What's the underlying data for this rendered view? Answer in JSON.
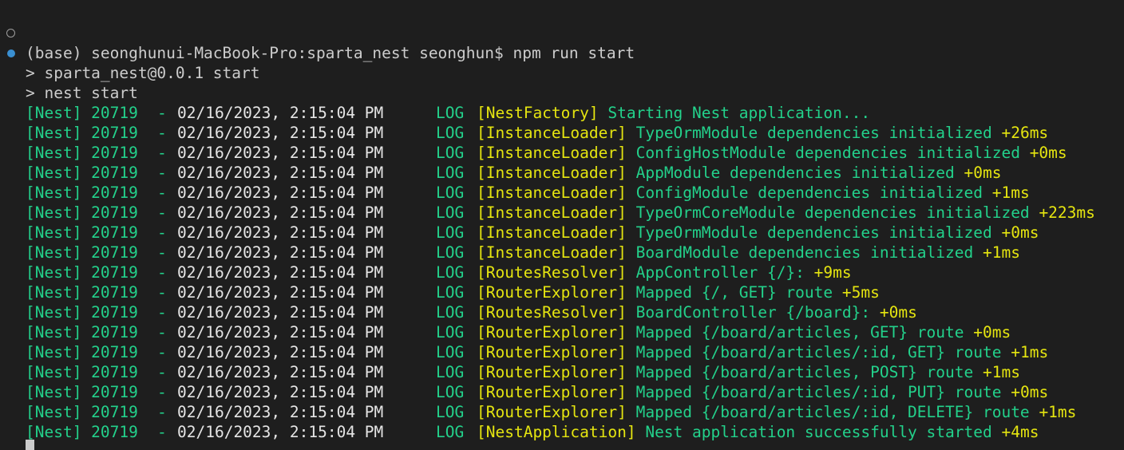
{
  "terminal": {
    "prompt_line": "(base) seonghunui-MacBook-Pro:sparta_nest seonghun$ npm run start",
    "script_line_1": "> sparta_nest@0.0.1 start",
    "script_line_2": "> nest start",
    "colors": {
      "background": "#1e1e1e",
      "default_text": "#cccccc",
      "log_green": "#23d18b",
      "timing_yellow": "#e5e510",
      "running_indicator": "#3a8fd1"
    },
    "log_entries": [
      {
        "prefix": "[Nest] 20719",
        "dash": "-",
        "timestamp": "02/16/2023, 2:15:04 PM",
        "level": "LOG",
        "context": "[NestFactory]",
        "message": "Starting Nest application...",
        "duration": ""
      },
      {
        "prefix": "[Nest] 20719",
        "dash": "-",
        "timestamp": "02/16/2023, 2:15:04 PM",
        "level": "LOG",
        "context": "[InstanceLoader]",
        "message": "TypeOrmModule dependencies initialized",
        "duration": "+26ms"
      },
      {
        "prefix": "[Nest] 20719",
        "dash": "-",
        "timestamp": "02/16/2023, 2:15:04 PM",
        "level": "LOG",
        "context": "[InstanceLoader]",
        "message": "ConfigHostModule dependencies initialized",
        "duration": "+0ms"
      },
      {
        "prefix": "[Nest] 20719",
        "dash": "-",
        "timestamp": "02/16/2023, 2:15:04 PM",
        "level": "LOG",
        "context": "[InstanceLoader]",
        "message": "AppModule dependencies initialized",
        "duration": "+0ms"
      },
      {
        "prefix": "[Nest] 20719",
        "dash": "-",
        "timestamp": "02/16/2023, 2:15:04 PM",
        "level": "LOG",
        "context": "[InstanceLoader]",
        "message": "ConfigModule dependencies initialized",
        "duration": "+1ms"
      },
      {
        "prefix": "[Nest] 20719",
        "dash": "-",
        "timestamp": "02/16/2023, 2:15:04 PM",
        "level": "LOG",
        "context": "[InstanceLoader]",
        "message": "TypeOrmCoreModule dependencies initialized",
        "duration": "+223ms"
      },
      {
        "prefix": "[Nest] 20719",
        "dash": "-",
        "timestamp": "02/16/2023, 2:15:04 PM",
        "level": "LOG",
        "context": "[InstanceLoader]",
        "message": "TypeOrmModule dependencies initialized",
        "duration": "+0ms"
      },
      {
        "prefix": "[Nest] 20719",
        "dash": "-",
        "timestamp": "02/16/2023, 2:15:04 PM",
        "level": "LOG",
        "context": "[InstanceLoader]",
        "message": "BoardModule dependencies initialized",
        "duration": "+1ms"
      },
      {
        "prefix": "[Nest] 20719",
        "dash": "-",
        "timestamp": "02/16/2023, 2:15:04 PM",
        "level": "LOG",
        "context": "[RoutesResolver]",
        "message": "AppController {/}:",
        "duration": "+9ms"
      },
      {
        "prefix": "[Nest] 20719",
        "dash": "-",
        "timestamp": "02/16/2023, 2:15:04 PM",
        "level": "LOG",
        "context": "[RouterExplorer]",
        "message": "Mapped {/, GET} route",
        "duration": "+5ms"
      },
      {
        "prefix": "[Nest] 20719",
        "dash": "-",
        "timestamp": "02/16/2023, 2:15:04 PM",
        "level": "LOG",
        "context": "[RoutesResolver]",
        "message": "BoardController {/board}:",
        "duration": "+0ms"
      },
      {
        "prefix": "[Nest] 20719",
        "dash": "-",
        "timestamp": "02/16/2023, 2:15:04 PM",
        "level": "LOG",
        "context": "[RouterExplorer]",
        "message": "Mapped {/board/articles, GET} route",
        "duration": "+0ms"
      },
      {
        "prefix": "[Nest] 20719",
        "dash": "-",
        "timestamp": "02/16/2023, 2:15:04 PM",
        "level": "LOG",
        "context": "[RouterExplorer]",
        "message": "Mapped {/board/articles/:id, GET} route",
        "duration": "+1ms"
      },
      {
        "prefix": "[Nest] 20719",
        "dash": "-",
        "timestamp": "02/16/2023, 2:15:04 PM",
        "level": "LOG",
        "context": "[RouterExplorer]",
        "message": "Mapped {/board/articles, POST} route",
        "duration": "+1ms"
      },
      {
        "prefix": "[Nest] 20719",
        "dash": "-",
        "timestamp": "02/16/2023, 2:15:04 PM",
        "level": "LOG",
        "context": "[RouterExplorer]",
        "message": "Mapped {/board/articles/:id, PUT} route",
        "duration": "+0ms"
      },
      {
        "prefix": "[Nest] 20719",
        "dash": "-",
        "timestamp": "02/16/2023, 2:15:04 PM",
        "level": "LOG",
        "context": "[RouterExplorer]",
        "message": "Mapped {/board/articles/:id, DELETE} route",
        "duration": "+1ms"
      },
      {
        "prefix": "[Nest] 20719",
        "dash": "-",
        "timestamp": "02/16/2023, 2:15:04 PM",
        "level": "LOG",
        "context": "[NestApplication]",
        "message": "Nest application successfully started",
        "duration": "+4ms"
      }
    ]
  }
}
